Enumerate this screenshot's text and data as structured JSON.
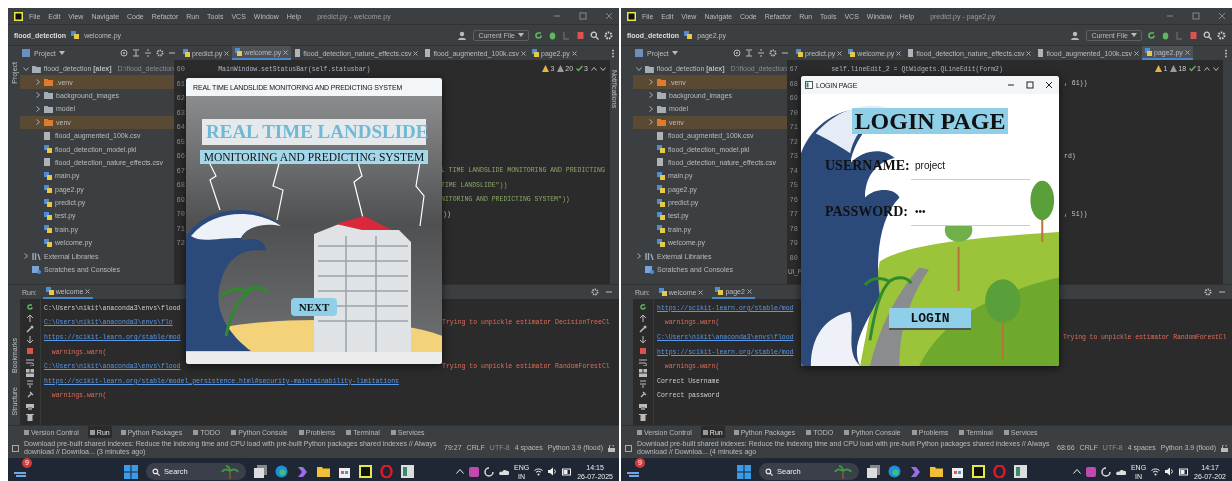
{
  "panes": [
    {
      "window_title": "predict.py - welcome.py",
      "menu": [
        "File",
        "Edit",
        "View",
        "Navigate",
        "Code",
        "Refactor",
        "Run",
        "Tools",
        "VCS",
        "Window",
        "Help"
      ],
      "breadcrumb": {
        "project": "flood_detection",
        "file": "welcome.py"
      },
      "run_config": "Current File",
      "project_header": "Project",
      "editor_tabs": [
        {
          "label": "predict.py",
          "kind": "py",
          "selected": false
        },
        {
          "label": "welcome.py",
          "kind": "py",
          "selected": true
        },
        {
          "label": "flood_detection_nature_effects.csv",
          "kind": "csv",
          "selected": false
        },
        {
          "label": "flood_augmented_100k.csv",
          "kind": "csv",
          "selected": false
        },
        {
          "label": "page2.py",
          "kind": "py",
          "selected": false
        }
      ],
      "side_labels": {
        "left_top": "Project",
        "left_bottom": [
          "Bookmarks",
          "Structure"
        ],
        "right": "Notifications"
      },
      "tree": [
        {
          "label": "flood_detection **[alex]**",
          "path": "D:\\flood_detection",
          "kind": "folder",
          "excluded": false,
          "expanded": true,
          "children": [
            {
              "label": ".venv",
              "kind": "folder",
              "excluded": true,
              "expanded": false
            },
            {
              "label": "background_images",
              "kind": "folder",
              "excluded": false,
              "expanded": false
            },
            {
              "label": "model",
              "kind": "folder",
              "excluded": false,
              "expanded": false
            },
            {
              "label": "venv",
              "kind": "folder",
              "excluded": true,
              "expanded": false
            },
            {
              "label": "flood_augmented_100k.csv",
              "kind": "csv"
            },
            {
              "label": "flood_detection_model.pkl",
              "kind": "pkl"
            },
            {
              "label": "flood_detection_nature_effects.csv",
              "kind": "csv"
            },
            {
              "label": "main.py",
              "kind": "py"
            },
            {
              "label": "page2.py",
              "kind": "py"
            },
            {
              "label": "predict.py",
              "kind": "py"
            },
            {
              "label": "test.py",
              "kind": "py"
            },
            {
              "label": "train.py",
              "kind": "py"
            },
            {
              "label": "welcome.py",
              "kind": "py"
            }
          ]
        },
        {
          "label": "External Libraries",
          "kind": "lib",
          "expanded": false
        },
        {
          "label": "Scratches and Consoles",
          "kind": "scratch"
        }
      ],
      "inspections": [
        {
          "kind": "warning",
          "count": "3"
        },
        {
          "kind": "weak",
          "count": "20"
        },
        {
          "kind": "ok",
          "count": "3"
        }
      ],
      "code_lines": [
        {
          "number": "60",
          "kind": "code",
          "text": "        MainWindow.setStatusBar(self.statusbar)"
        },
        {
          "number": "61"
        },
        {
          "number": "62"
        },
        {
          "number": "63"
        },
        {
          "number": "64"
        },
        {
          "number": "65"
        },
        {
          "number": "66"
        },
        {
          "number": "67",
          "kind": "string-tail",
          "text": "L TIME LANDSLIDE MONITORING AND PREDICTING"
        },
        {
          "number": "68",
          "kind": "string-tail",
          "text": "TIME LANDSLIDE\"))"
        },
        {
          "number": "69",
          "kind": "string-tail",
          "text": "NITORING AND PREDICTING SYSTEM\"))"
        },
        {
          "number": "70",
          "kind": "tail",
          "text": "))"
        },
        {
          "number": "71"
        },
        {
          "number": "72"
        }
      ],
      "run_label": "Run:",
      "run_tabs": [
        {
          "label": "welcome",
          "selected": true
        }
      ],
      "console": [
        {
          "kind": "plain",
          "text": "C:\\Users\\nikit\\anaconda3\\envs\\flood"
        },
        {
          "kind": "link",
          "text": "C:\\Users\\nikit\\anaconda3\\envs\\flo",
          "message": "Trying to unpickle estimator DecisionTreeCl"
        },
        {
          "kind": "link",
          "text": "https://scikit-learn.org/stable/mod"
        },
        {
          "kind": "warn",
          "text": "  warnings.warn("
        },
        {
          "kind": "link",
          "text": "C:\\Users\\nikit\\anaconda3\\envs\\flood",
          "message": "Trying to unpickle estimator RandomForestCl"
        },
        {
          "kind": "link",
          "text": "https://scikit-learn.org/stable/model_persistence.html#security-maintainability-limitations"
        },
        {
          "kind": "warn",
          "text": "  warnings.warn("
        }
      ],
      "tool_tabs": [
        {
          "label": "Version Control",
          "selected": false
        },
        {
          "label": "Run",
          "selected": true
        },
        {
          "label": "Python Packages",
          "selected": false
        },
        {
          "label": "TODO",
          "selected": false
        },
        {
          "label": "Python Console",
          "selected": false
        },
        {
          "label": "Problems",
          "selected": false
        },
        {
          "label": "Terminal",
          "selected": false
        },
        {
          "label": "Services",
          "selected": false
        }
      ],
      "status": {
        "message": "Download pre-built shared indexes: Reduce the indexing time and CPU load with pre-built Python packages shared indexes // Always download // Downloa... (3 minutes ago)",
        "items": [
          "79:27",
          "CRLF",
          "UTF-8",
          "4 spaces",
          "Python 3.9 (flood)"
        ]
      },
      "dialog": {
        "kind": "welcome",
        "title": "REAL TIME LANDSLIDE MONITORING AND PREDICTING SYSTEM",
        "headline": "REAL TIME LANDSLIDE",
        "subheadline": "MONITORING AND PREDICTING SYSTEM",
        "button": "NEXT"
      },
      "taskbar": {
        "badge": "9",
        "search": "Search",
        "lang": "ENG",
        "region": "IN",
        "time": "14:15",
        "date": "26-07-2025"
      }
    },
    {
      "window_title": "predict.py - page2.py",
      "menu": [
        "File",
        "Edit",
        "View",
        "Navigate",
        "Code",
        "Refactor",
        "Run",
        "Tools",
        "VCS",
        "Window",
        "Help"
      ],
      "breadcrumb": {
        "project": "flood_detection",
        "file": "page2.py"
      },
      "run_config": "Current File",
      "project_header": "Project",
      "editor_tabs": [
        {
          "label": "predict.py",
          "kind": "py",
          "selected": false
        },
        {
          "label": "welcome.py",
          "kind": "py",
          "selected": false
        },
        {
          "label": "flood_detection_nature_effects.csv",
          "kind": "csv",
          "selected": false
        },
        {
          "label": "flood_augmented_100k.csv",
          "kind": "csv",
          "selected": false
        },
        {
          "label": "page2.py",
          "kind": "py",
          "selected": true
        }
      ],
      "tree": [
        {
          "label": "flood_detection **[alex]**",
          "path": "D:\\flood_detection",
          "kind": "folder",
          "excluded": false,
          "expanded": true,
          "children": [
            {
              "label": ".venv",
              "kind": "folder",
              "excluded": true,
              "expanded": false
            },
            {
              "label": "background_images",
              "kind": "folder",
              "excluded": false,
              "expanded": false
            },
            {
              "label": "model",
              "kind": "folder",
              "excluded": false,
              "expanded": false
            },
            {
              "label": "venv",
              "kind": "folder",
              "excluded": true,
              "expanded": false
            },
            {
              "label": "flood_augmented_100k.csv",
              "kind": "csv"
            },
            {
              "label": "flood_detection_model.pkl",
              "kind": "pkl"
            },
            {
              "label": "flood_detection_nature_effects.csv",
              "kind": "csv"
            },
            {
              "label": "main.py",
              "kind": "py"
            },
            {
              "label": "page2.py",
              "kind": "py"
            },
            {
              "label": "predict.py",
              "kind": "py"
            },
            {
              "label": "test.py",
              "kind": "py"
            },
            {
              "label": "train.py",
              "kind": "py"
            },
            {
              "label": "welcome.py",
              "kind": "py"
            }
          ]
        },
        {
          "label": "External Libraries",
          "kind": "lib",
          "expanded": false
        },
        {
          "label": "Scratches and Consoles",
          "kind": "scratch"
        }
      ],
      "inspections": [
        {
          "kind": "warning",
          "count": "1"
        },
        {
          "kind": "weak",
          "count": "18"
        },
        {
          "kind": "ok",
          "count": "1"
        }
      ],
      "code_lines": [
        {
          "number": "67",
          "kind": "code",
          "text": "        self.lineEdit_2 = QtWidgets.QLineEdit(Form2)"
        },
        {
          "number": "68",
          "kind": "tail",
          "text": ", 61))"
        },
        {
          "number": "69"
        },
        {
          "number": "70"
        },
        {
          "number": "71"
        },
        {
          "number": "72"
        },
        {
          "number": "73",
          "kind": "tail",
          "text": "rd)"
        },
        {
          "number": "74"
        },
        {
          "number": "75"
        },
        {
          "number": "76"
        },
        {
          "number": "77",
          "kind": "tail",
          "text": ", 51))"
        },
        {
          "number": "78"
        },
        {
          "number": "79"
        },
        {
          "number": "80"
        }
      ],
      "editor_footer": "Ui_F",
      "run_label": "Run:",
      "run_tabs": [
        {
          "label": "welcome",
          "selected": false
        },
        {
          "label": "page2",
          "selected": true
        }
      ],
      "console": [
        {
          "kind": "link",
          "text": "https://scikit-learn.org/stable/mod"
        },
        {
          "kind": "warn",
          "text": "  warnings.warn("
        },
        {
          "kind": "link",
          "text": "C:\\Users\\nikit\\anaconda3\\envs\\flood",
          "message": "Trying to unpickle estimator RandomForestCl"
        },
        {
          "kind": "link",
          "text": "https://scikit-learn.org/stable/mod"
        },
        {
          "kind": "warn",
          "text": "  warnings.warn("
        },
        {
          "kind": "plain",
          "text": "Correct Username"
        },
        {
          "kind": "plain",
          "text": "Correct password"
        }
      ],
      "tool_tabs": [
        {
          "label": "Version Control",
          "selected": false
        },
        {
          "label": "Run",
          "selected": true
        },
        {
          "label": "Python Packages",
          "selected": false
        },
        {
          "label": "TODO",
          "selected": false
        },
        {
          "label": "Python Console",
          "selected": false
        },
        {
          "label": "Problems",
          "selected": false
        },
        {
          "label": "Terminal",
          "selected": false
        },
        {
          "label": "Services",
          "selected": false
        }
      ],
      "status": {
        "message": "Download pre-built shared indexes: Reduce the indexing time and CPU load with pre-built Python packages shared indexes // Always download // Downloa... (4 minutes ago",
        "items": [
          "68:66",
          "CRLF",
          "UTF-8",
          "4 spaces",
          "Python 3.9 (flood)"
        ]
      },
      "dialog": {
        "kind": "login",
        "title": "LOGIN PAGE",
        "heading": "LOGIN PAGE",
        "fields": [
          {
            "label": "USERNAME:",
            "value": "project"
          },
          {
            "label": "PASSWORD:",
            "value": "•••"
          }
        ],
        "button": "LOGIN"
      },
      "taskbar": {
        "badge": "9",
        "search": "Search",
        "lang": "ENG",
        "region": "IN",
        "time": "14:17",
        "date": "26-07-202"
      }
    }
  ]
}
